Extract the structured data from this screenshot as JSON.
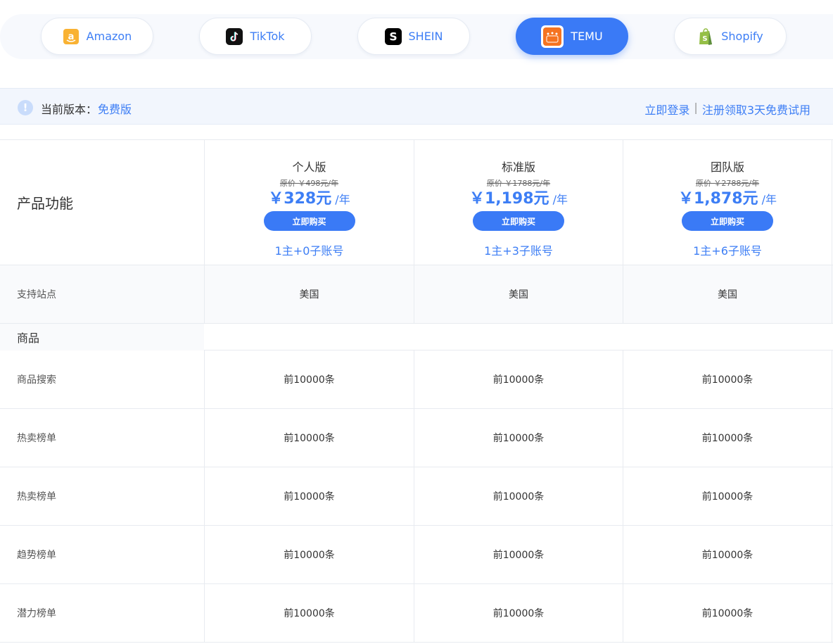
{
  "platform_tabs": [
    {
      "label": "Amazon",
      "icon": "amazon-logo-icon",
      "active": false
    },
    {
      "label": "TikTok",
      "icon": "tiktok-logo-icon",
      "active": false
    },
    {
      "label": "SHEIN",
      "icon": "shein-logo-icon",
      "active": false
    },
    {
      "label": "TEMU",
      "icon": "temu-logo-icon",
      "active": true
    },
    {
      "label": "Shopify",
      "icon": "shopify-logo-icon",
      "active": false
    }
  ],
  "notice": {
    "version_label": "当前版本：",
    "version_value": "免费版",
    "login_link": "立即登录",
    "separator": "|",
    "register_link": "注册领取3天免费试用"
  },
  "table": {
    "feature_header": "产品功能",
    "plans": [
      {
        "name": "个人版",
        "original_price": "原价 ￥498元/年",
        "price": "￥328元",
        "unit": " /年",
        "buy_label": "立即购买",
        "accounts": "1主+0子账号"
      },
      {
        "name": "标准版",
        "original_price": "原价 ￥1788元/年",
        "price": "￥1,198元",
        "unit": " /年",
        "buy_label": "立即购买",
        "accounts": "1主+3子账号"
      },
      {
        "name": "团队版",
        "original_price": "原价 ￥2788元/年",
        "price": "￥1,878元",
        "unit": " /年",
        "buy_label": "立即购买",
        "accounts": "1主+6子账号"
      }
    ],
    "site_row": {
      "label": "支持站点",
      "values": [
        "美国",
        "美国",
        "美国"
      ]
    },
    "group_label": "商品",
    "features": [
      {
        "label": "商品搜索",
        "values": [
          "前10000条",
          "前10000条",
          "前10000条"
        ]
      },
      {
        "label": "热卖榜单",
        "values": [
          "前10000条",
          "前10000条",
          "前10000条"
        ]
      },
      {
        "label": "热卖榜单",
        "values": [
          "前10000条",
          "前10000条",
          "前10000条"
        ]
      },
      {
        "label": "趋势榜单",
        "values": [
          "前10000条",
          "前10000条",
          "前10000条"
        ]
      },
      {
        "label": "潜力榜单",
        "values": [
          "前10000条",
          "前10000条",
          "前10000条"
        ]
      }
    ]
  },
  "colors": {
    "accent": "#3a7af6",
    "link": "#3d7ef5",
    "notice_bg": "#f2f6fd"
  }
}
